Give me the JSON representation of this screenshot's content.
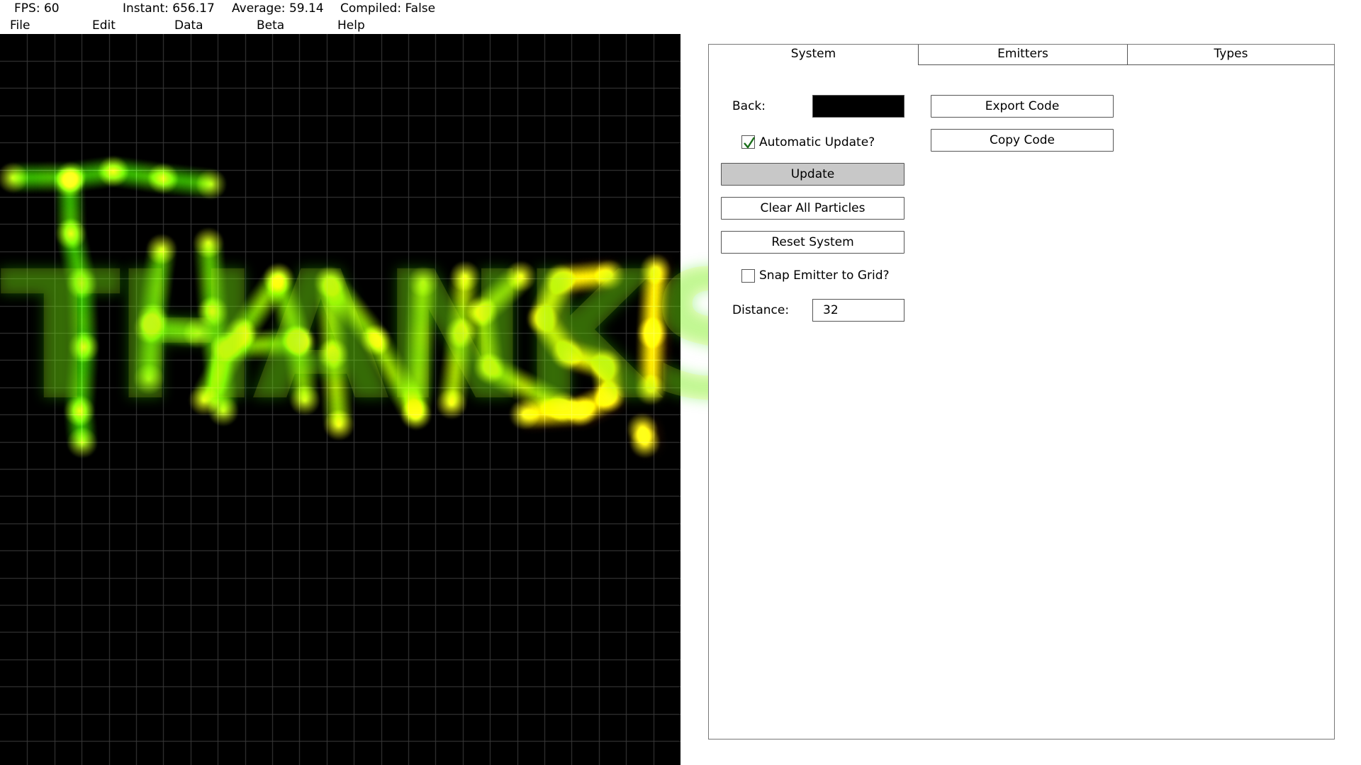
{
  "stats": {
    "fps": "FPS: 60",
    "instant": "Instant: 656.17",
    "average": "Average: 59.14",
    "compiled": "Compiled: False"
  },
  "menu": [
    "File",
    "Edit",
    "Data",
    "Beta",
    "Help"
  ],
  "viewport": {
    "background": "#000000",
    "grid_color": "#3a3a3a",
    "particle_text": "THANKS!",
    "particle_colors": [
      "#33e000",
      "#ffff00",
      "#ff6a00"
    ]
  },
  "panel": {
    "tabs": [
      {
        "label": "System",
        "active": true
      },
      {
        "label": "Emitters",
        "active": false
      },
      {
        "label": "Types",
        "active": false
      }
    ],
    "back_label": "Back:",
    "back_color": "#000000",
    "export_code": "Export Code",
    "copy_code": "Copy Code",
    "automatic_update_label": "Automatic Update?",
    "automatic_update_checked": true,
    "update": "Update",
    "clear_all_particles": "Clear All Particles",
    "reset_system": "Reset System",
    "snap_label": "Snap Emitter to Grid?",
    "snap_checked": false,
    "distance_label": "Distance:",
    "distance_value": "32"
  }
}
